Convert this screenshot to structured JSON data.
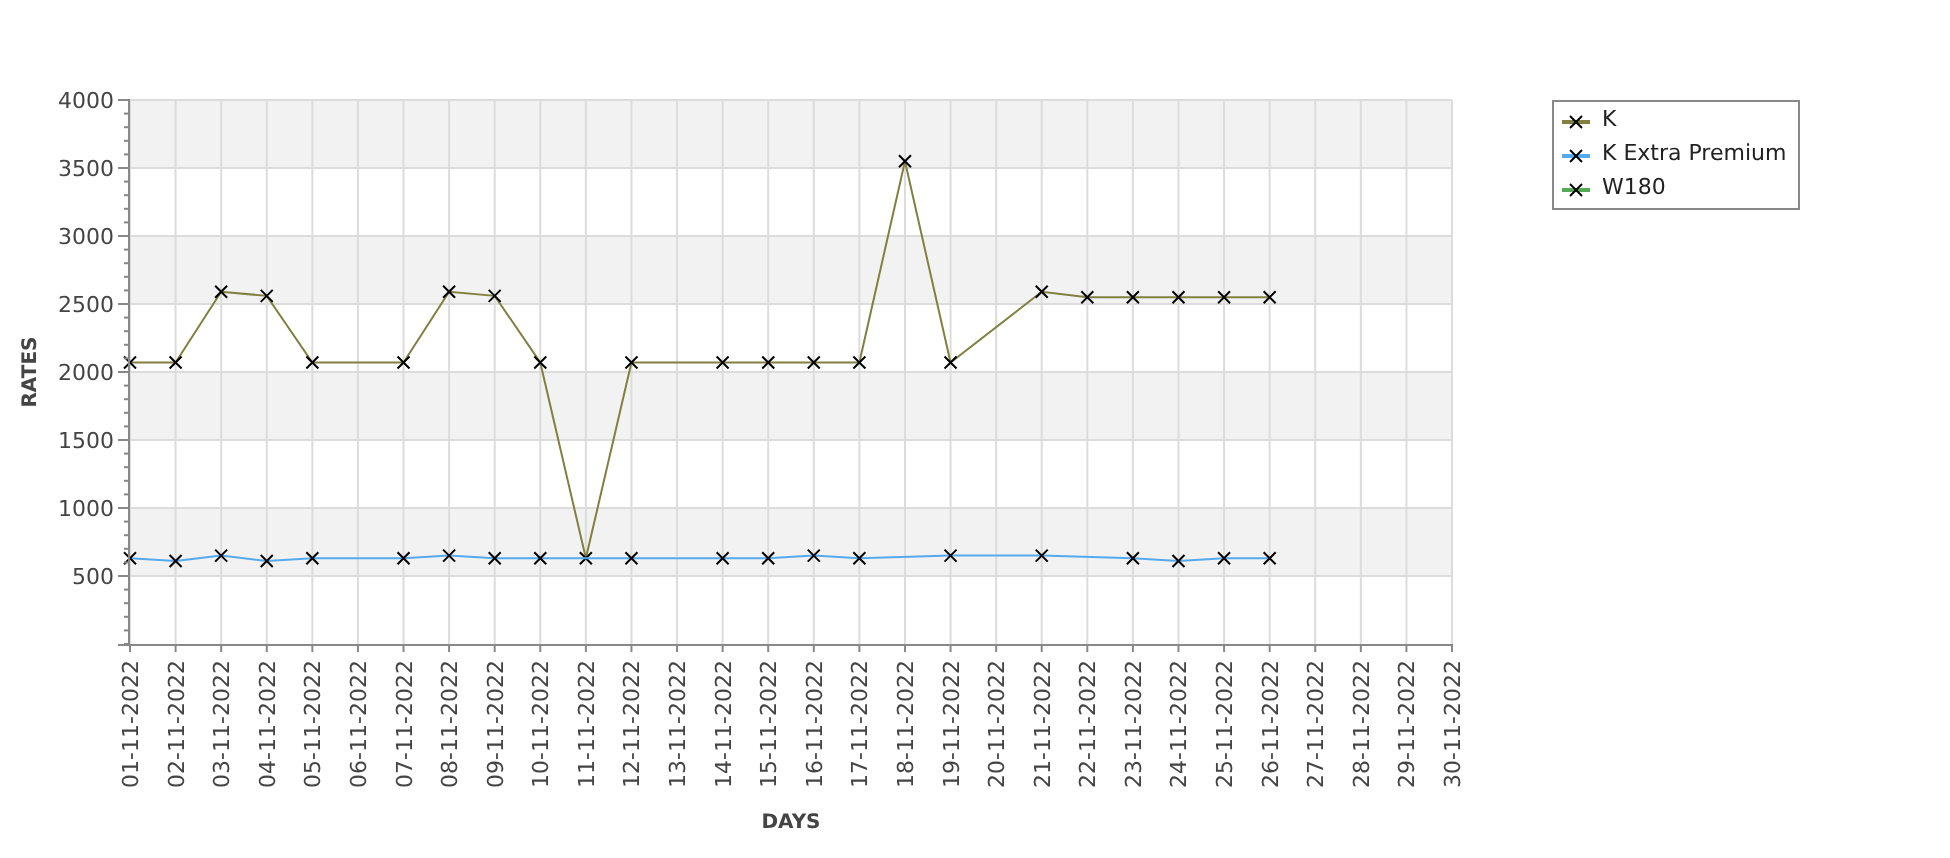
{
  "chart": {
    "chart_data": {
      "type": "line",
      "xlabel": "DAYS",
      "ylabel": "RATES",
      "categories": [
        "01-11-2022",
        "02-11-2022",
        "03-11-2022",
        "04-11-2022",
        "05-11-2022",
        "06-11-2022",
        "07-11-2022",
        "08-11-2022",
        "09-11-2022",
        "10-11-2022",
        "11-11-2022",
        "12-11-2022",
        "13-11-2022",
        "14-11-2022",
        "15-11-2022",
        "16-11-2022",
        "17-11-2022",
        "18-11-2022",
        "19-11-2022",
        "20-11-2022",
        "21-11-2022",
        "22-11-2022",
        "23-11-2022",
        "24-11-2022",
        "25-11-2022",
        "26-11-2022",
        "27-11-2022",
        "28-11-2022",
        "29-11-2022",
        "30-11-2022"
      ],
      "series": [
        {
          "name": "K",
          "color": "#808040",
          "marker": "x",
          "values": [
            2070,
            2070,
            2590,
            2560,
            2070,
            null,
            2070,
            2590,
            2560,
            2070,
            630,
            2070,
            null,
            2070,
            2070,
            2070,
            2070,
            3550,
            2070,
            null,
            2590,
            2550,
            2550,
            2550,
            2550,
            2550,
            null,
            null,
            null,
            null
          ]
        },
        {
          "name": "K Extra Premium",
          "color": "#55aaee",
          "marker": "x",
          "values": [
            630,
            610,
            650,
            610,
            630,
            null,
            630,
            650,
            630,
            630,
            630,
            630,
            null,
            630,
            630,
            650,
            630,
            null,
            650,
            null,
            650,
            null,
            630,
            610,
            630,
            630,
            null,
            null,
            null,
            null
          ]
        },
        {
          "name": "W180",
          "color": "#55aa55",
          "values": [
            null,
            null,
            null,
            null,
            null,
            null,
            null,
            null,
            null,
            null,
            null,
            null,
            null,
            null,
            null,
            null,
            null,
            null,
            null,
            null,
            null,
            null,
            null,
            null,
            null,
            null,
            null,
            null,
            null,
            null
          ]
        }
      ],
      "grid": true,
      "ylim": [
        0,
        4000
      ],
      "yticks": [
        500,
        1000,
        1500,
        2000,
        2500,
        3000,
        3500,
        4000
      ]
    }
  }
}
